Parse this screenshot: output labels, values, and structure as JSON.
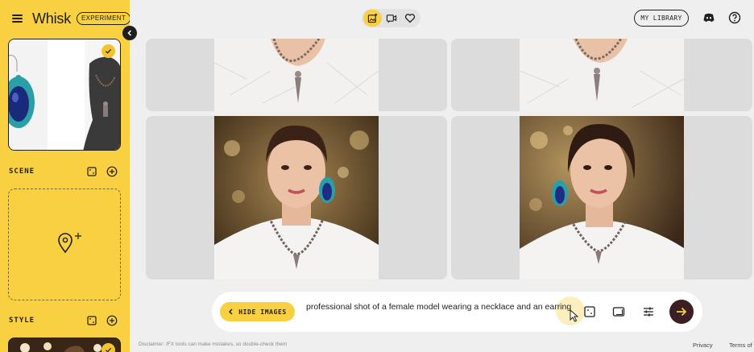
{
  "app": {
    "name": "Whisk",
    "badge": "EXPERIMENT"
  },
  "sidebar": {
    "sections": [
      {
        "label": "SCENE"
      },
      {
        "label": "STYLE"
      }
    ],
    "icons": {
      "menu": "hamburger-icon",
      "check": "check-icon",
      "dice": "dice-icon",
      "add": "add-icon",
      "location": "location-pin-icon",
      "collapse": "chevron-left-icon"
    }
  },
  "header": {
    "modes": [
      "image-mode-icon",
      "video-mode-icon",
      "favorites-icon"
    ],
    "library_label": "MY LIBRARY",
    "icons": [
      "discord-icon",
      "help-icon"
    ]
  },
  "prompt_bar": {
    "hide_label": "HIDE IMAGES",
    "prompt": "professional shot of a female model wearing a necklace and an earring",
    "tools": [
      "aspect-ratio-icon",
      "image-format-icon",
      "settings-sliders-icon"
    ],
    "send": "arrow-right-icon"
  },
  "footer": {
    "disclaimer": "Disclaimer: /FX tools can make mistakes, so double-check them",
    "links": [
      "Privacy",
      "Terms of"
    ]
  },
  "colors": {
    "accent": "#f9d041",
    "send": "#3b1f23",
    "background": "#efefef"
  }
}
